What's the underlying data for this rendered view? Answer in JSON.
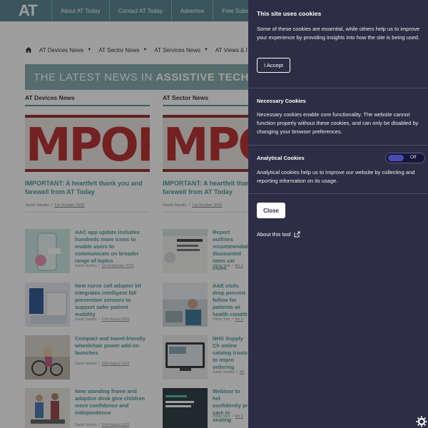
{
  "header": {
    "logo": "AT",
    "links": [
      "About AT Today",
      "Contact AT Today",
      "Advertise",
      "Free Subscription"
    ]
  },
  "nav": {
    "items": [
      "AT Devices News",
      "AT Sector News",
      "AT Services News",
      "AT Views & I"
    ]
  },
  "banner": {
    "text_light": "THE LATEST NEWS IN ",
    "text_bold": "ASSISTIVE TECHNOLOGY"
  },
  "columns": [
    {
      "heading": "AT Devices News",
      "hero": {
        "image_word": "IMPORTANT",
        "title": "IMPORTANT: A heartfelt thank you and farewell from AT Today",
        "author": "Sarah Sandry",
        "date": "1st October 2025"
      },
      "items": [
        {
          "title": "AAC app update includes hundreds more icons to enable users to communicate on broader range of topics",
          "author": "Sarah Sandry",
          "date": "1st September 2025"
        },
        {
          "title": "New nurse call adaptor kit integrates intelligent fall prevention sensors to support safer patient mobility",
          "author": "Sarah Sandry",
          "date": "27th August 2025"
        },
        {
          "title": "Compact and travel-friendly wheelchair power add-on launches",
          "author": "Sarah Sandry",
          "date": "26th August 2025"
        },
        {
          "title": "New standing frame and adaptive desk give children more confidence and independence",
          "author": "Sarah Sandry",
          "date": "20th August 2025"
        }
      ]
    },
    {
      "heading": "AT Sector News",
      "hero": {
        "image_word": "IMPORTANT",
        "title": "IMPORTANT: A heartfelt thank you and farewell from AT Today",
        "author": "Sarah Sandry",
        "date": "1st October 2025"
      },
      "items": [
        {
          "title": "Report outlines recommendations discounted rates car clubs",
          "author": "Hillzie York",
          "date": "8th S"
        },
        {
          "title": "A&E visits drop percent follow for patients wi health conditi",
          "author": "Hillzie York",
          "date": "5th S"
        },
        {
          "title": "NHS Supply Ch online catalog trusts to impro ordering",
          "author": "Sarah Sandry",
          "date": "4th"
        },
        {
          "title": "Webinar to hel confidently pr care in seating",
          "author": "Hillzie York",
          "date": "4th S"
        }
      ]
    }
  ],
  "cookie": {
    "title": "This site uses cookies",
    "intro": "Some of these cookies are essential, while others help us to improve your experience by providing insights into how the site is being used.",
    "accept_label": "I Accept",
    "necessary_title": "Necessary Cookies",
    "necessary_text": "Necessary cookies enable core functionality. The website cannot function properly without these cookies, and can only be disabled by changing your browser preferences.",
    "analytical_title": "Analytical Cookies",
    "analytical_toggle": "Off",
    "analytical_text": "Analytical cookies help us to improve our website by collecting and reporting information on its usage.",
    "close_label": "Close",
    "about_label": "About this tool"
  },
  "colors": {
    "teal": "#3a8f95",
    "panel": "#2d2e45",
    "header": "#4a7a85"
  }
}
